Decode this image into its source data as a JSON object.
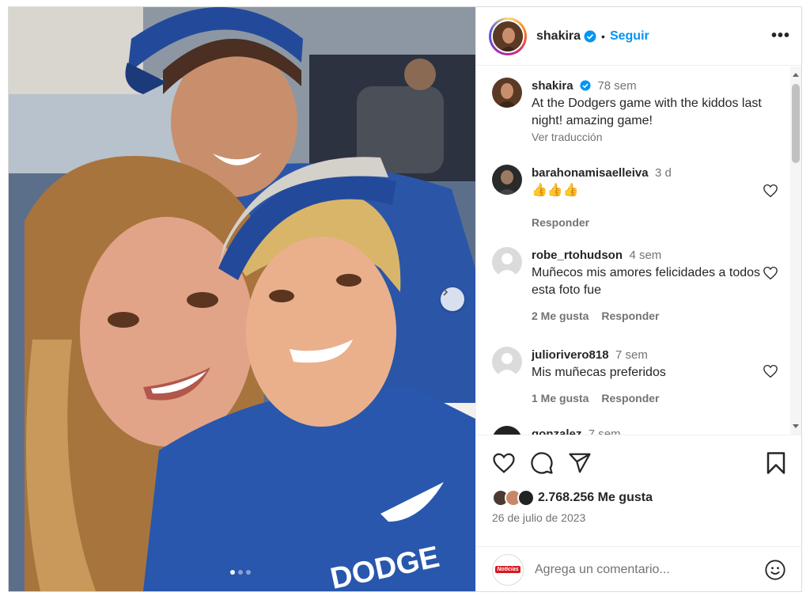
{
  "post": {
    "author": "shakira",
    "follow_label": "Seguir",
    "separator": "•",
    "more_label": "•••",
    "caption": {
      "user": "shakira",
      "time": "78 sem",
      "text": "At the Dodgers game with the kiddos last night! amazing game!",
      "translate_label": "Ver traducción"
    },
    "comments": [
      {
        "user": "barahonamisaelleiva",
        "time": "3 d",
        "text": "👍👍👍",
        "likes": "",
        "reply_label": "Responder"
      },
      {
        "user": "robe_rtohudson",
        "time": "4 sem",
        "text": "Muñecos mis amores felicidades a todos esta foto fue",
        "likes": "2 Me gusta",
        "reply_label": "Responder"
      },
      {
        "user": "juliorivero818",
        "time": "7 sem",
        "text": "Mis muñecas preferidos",
        "likes": "1 Me gusta",
        "reply_label": "Responder"
      },
      {
        "user": "gonzalez",
        "time": "7 sem",
        "text": "",
        "likes": "",
        "reply_label": ""
      }
    ],
    "likes_count": "2.768.256 Me gusta",
    "date": "26 de julio de 2023",
    "add_comment_placeholder": "Agrega un comentario...",
    "commenter_brand": "Noticias",
    "carousel": {
      "slide_count": 3,
      "active_index": 0
    }
  },
  "colors": {
    "accent": "#0095f6",
    "verified": "#0095f6",
    "text": "#262626",
    "muted": "#737373",
    "border": "#efefef"
  },
  "icons": [
    "verified-badge-icon",
    "more-options-icon",
    "like-heart-icon",
    "comment-bubble-icon",
    "share-paper-plane-icon",
    "save-bookmark-icon",
    "emoji-smiley-icon",
    "next-chevron-icon"
  ]
}
